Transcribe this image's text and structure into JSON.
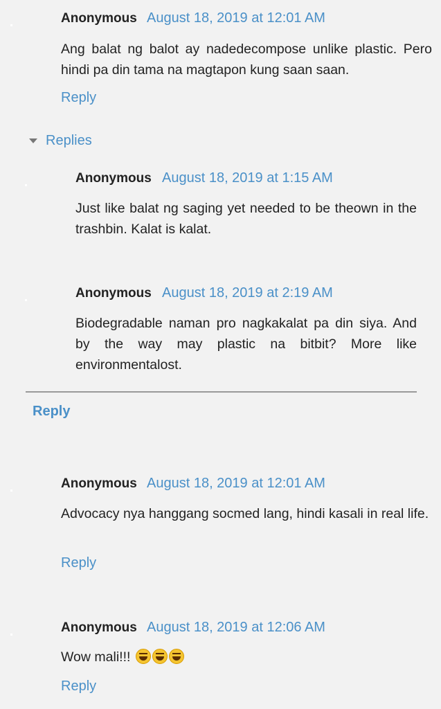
{
  "comments": [
    {
      "author": "Anonymous",
      "timestamp": "August 18, 2019 at 12:01 AM",
      "text": "Ang balat ng balot ay nadedecompose unlike plastic. Pero hindi pa din tama na magtapon kung saan saan.",
      "reply_label": "Reply",
      "replies_toggle_label": "Replies",
      "replies": [
        {
          "author": "Anonymous",
          "timestamp": "August 18, 2019 at 1:15 AM",
          "text": "Just like balat ng saging yet needed to be theown in the trashbin. Kalat is kalat."
        },
        {
          "author": "Anonymous",
          "timestamp": "August 18, 2019 at 2:19 AM",
          "text": "Biodegradable naman pro nagkakalat pa din siya. And by the way may plastic na bitbit? More like environmentalost."
        }
      ],
      "thread_reply_label": "Reply"
    },
    {
      "author": "Anonymous",
      "timestamp": "August 18, 2019 at 12:01 AM",
      "text": "Advocacy nya hanggang socmed lang, hindi kasali in real life.",
      "reply_label": "Reply"
    },
    {
      "author": "Anonymous",
      "timestamp": "August 18, 2019 at 12:06 AM",
      "text": "Wow mali!!!",
      "emoji": [
        "rolling-on-floor-laughing-emoji",
        "rolling-on-floor-laughing-emoji",
        "rolling-on-floor-laughing-emoji"
      ],
      "reply_label": "Reply"
    }
  ],
  "colors": {
    "background": "#f2f2f2",
    "link": "#4a90c8",
    "text": "#222222",
    "divider": "#999999"
  }
}
